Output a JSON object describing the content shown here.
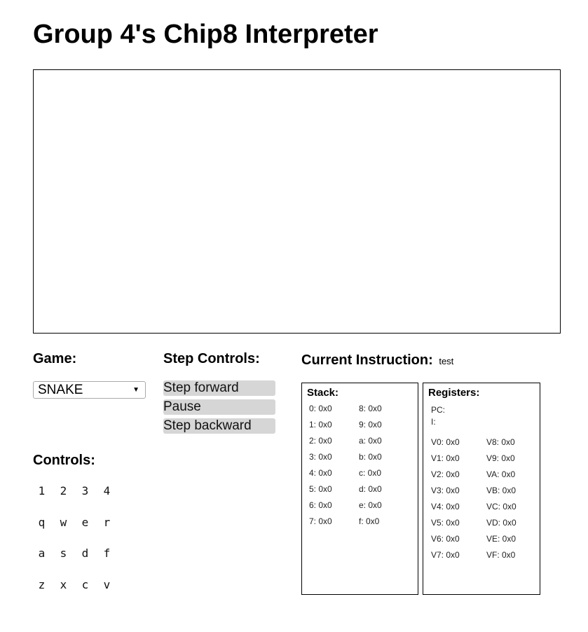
{
  "header": {
    "title": "Group 4's Chip8 Interpreter"
  },
  "game": {
    "label": "Game:",
    "selected": "SNAKE",
    "arrow_icon": "▼"
  },
  "step_controls": {
    "label": "Step Controls:",
    "buttons": [
      "Step forward",
      "Pause",
      "Step backward"
    ]
  },
  "current_instruction": {
    "label": "Current Instruction:",
    "value": "test"
  },
  "controls": {
    "label": "Controls:",
    "keys": [
      "1",
      "2",
      "3",
      "4",
      "q",
      "w",
      "e",
      "r",
      "a",
      "s",
      "d",
      "f",
      "z",
      "x",
      "c",
      "v"
    ]
  },
  "stack": {
    "title": "Stack:",
    "entries": [
      "0: 0x0",
      "1: 0x0",
      "2: 0x0",
      "3: 0x0",
      "4: 0x0",
      "5: 0x0",
      "6: 0x0",
      "7: 0x0",
      "8: 0x0",
      "9: 0x0",
      "a: 0x0",
      "b: 0x0",
      "c: 0x0",
      "d: 0x0",
      "e: 0x0",
      "f: 0x0"
    ]
  },
  "registers": {
    "title": "Registers:",
    "pc": "PC:",
    "i": "I:",
    "entries": [
      "V0: 0x0",
      "V1: 0x0",
      "V2: 0x0",
      "V3: 0x0",
      "V4: 0x0",
      "V5: 0x0",
      "V6: 0x0",
      "V7: 0x0",
      "V8: 0x0",
      "V9: 0x0",
      "VA: 0x0",
      "VB: 0x0",
      "VC: 0x0",
      "VD: 0x0",
      "VE: 0x0",
      "VF: 0x0"
    ]
  }
}
